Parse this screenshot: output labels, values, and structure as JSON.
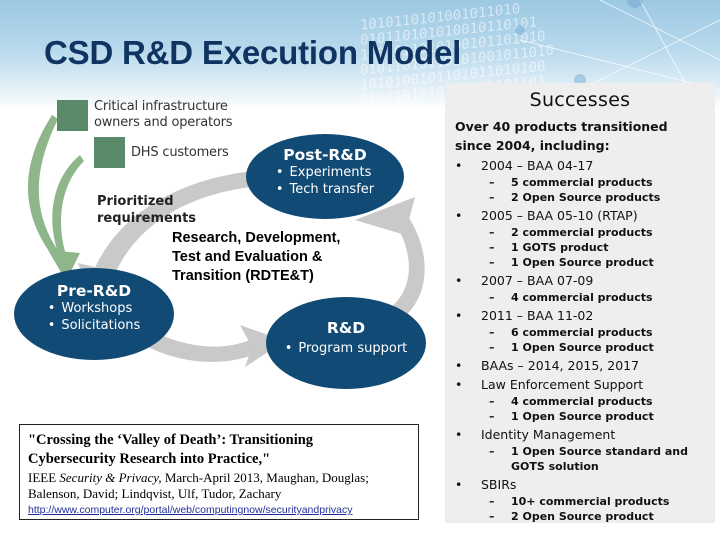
{
  "slide": {
    "title": "CSD R&D Execution Model",
    "background_binary": "1010110101001011010\n010110101010010110101\n1101011010100101101010\n01011010110101001011010\n1010100101101011010100\n0101101010010110101101"
  },
  "colors": {
    "title": "#0f3461",
    "oval_fill": "#114a74",
    "legend_square": "#5a8a6a",
    "green_arrow": "#8fb58a",
    "grey_cycle": "#c9c9c9",
    "successes_panel": "#eeeeee",
    "link": "#1f2f9a"
  },
  "diagram": {
    "legend": [
      {
        "label_line1": "Critical infrastructure",
        "label_line2": "owners and operators"
      },
      {
        "label_line1": "DHS customers",
        "label_line2": ""
      }
    ],
    "prioritized_label_line1": "Prioritized",
    "prioritized_label_line2": "requirements",
    "center_label_line1": "Research, Development,",
    "center_label_line2": "Test and Evaluation &",
    "center_label_line3": "Transition (RDTE&T)",
    "stages": [
      {
        "title": "Post-R&D",
        "bullets": [
          "Experiments",
          "Tech transfer"
        ]
      },
      {
        "title": "Pre-R&D",
        "bullets": [
          "Workshops",
          "Solicitations"
        ]
      },
      {
        "title": "R&D",
        "bullets": [
          "Program support"
        ]
      }
    ]
  },
  "reference": {
    "title_line1": "\"Crossing the ‘Valley of Death’: Transitioning",
    "title_line2": "Cybersecurity Research into Practice,\"",
    "publisher_prefix": "IEEE ",
    "journal": "Security & Privacy,",
    "details_line1": " March-April 2013, Maughan, Douglas;",
    "details_line2": "Balenson, David; Lindqvist, Ulf, Tudor, Zachary",
    "link": "http://www.computer.org/portal/web/computingnow/securityandprivacy"
  },
  "successes": {
    "heading": "Successes",
    "intro": "Over 40 products transitioned since 2004, including:",
    "items": [
      {
        "label": "2004 – BAA 04-17",
        "subs": [
          "5 commercial products",
          "2 Open Source products"
        ]
      },
      {
        "label": "2005 – BAA 05-10 (RTAP)",
        "subs": [
          "2 commercial products",
          "1 GOTS product",
          "1 Open Source product"
        ]
      },
      {
        "label": "2007 – BAA 07-09",
        "subs": [
          "4 commercial products"
        ]
      },
      {
        "label": "2011 – BAA 11-02",
        "subs": [
          "6 commercial products",
          "1 Open Source product"
        ]
      },
      {
        "label": "BAAs – 2014, 2015, 2017",
        "subs": []
      },
      {
        "label": "Law Enforcement Support",
        "subs": [
          "4 commercial products",
          "1 Open Source product"
        ]
      },
      {
        "label": "Identity Management",
        "subs": [
          "1 Open Source standard and GOTS solution"
        ]
      },
      {
        "label": "SBIRs",
        "subs": [
          "10+ commercial products",
          "2 Open Source product"
        ]
      }
    ]
  }
}
